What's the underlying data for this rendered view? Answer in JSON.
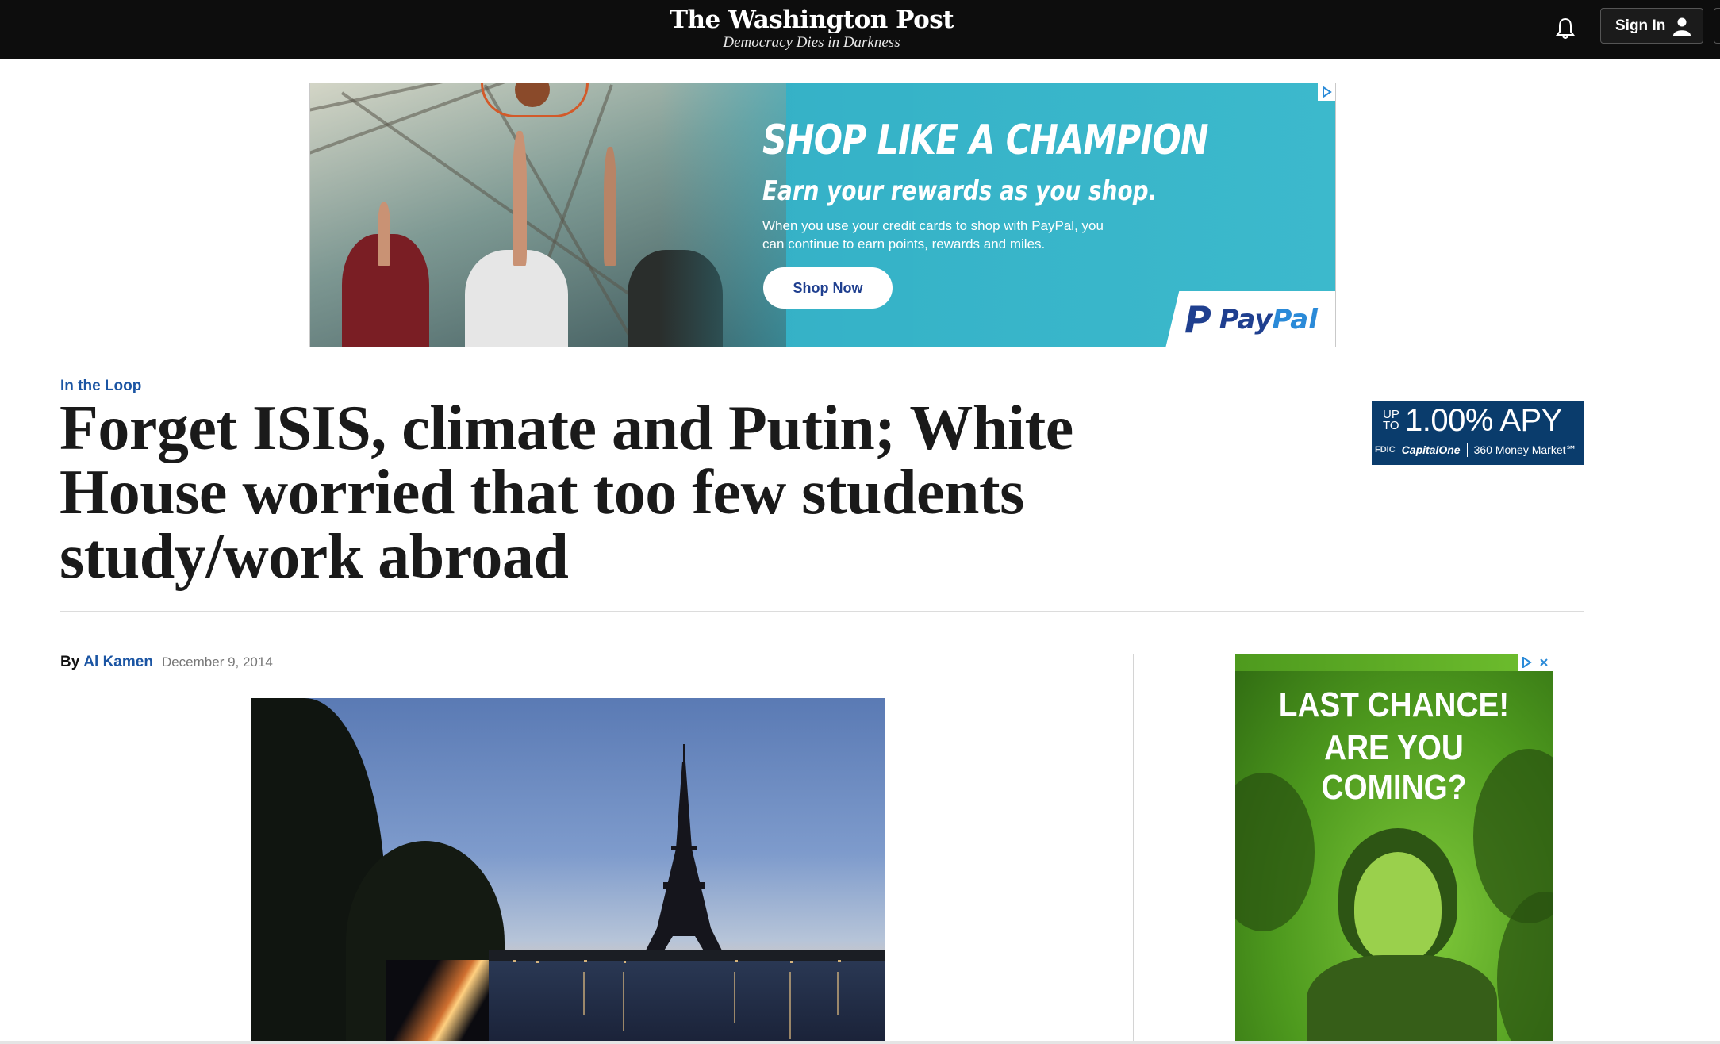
{
  "masthead": {
    "logo": "The Washington Post",
    "tagline": "Democracy Dies in Darkness"
  },
  "header": {
    "signin_label": "Sign In",
    "notification_icon": "bell-icon",
    "user_icon": "user-icon"
  },
  "ad_top": {
    "headline": "SHOP LIKE A CHAMPION",
    "subhead": "Earn your rewards as you shop.",
    "body": "When you use your credit cards to shop with PayPal, you can continue to earn points, rewards and miles.",
    "cta": "Shop Now",
    "brand_pay": "Pay",
    "brand_pal": "Pal",
    "brand_mark": "P",
    "adchoices_icon": "adchoices-icon"
  },
  "article": {
    "kicker": "In the Loop",
    "headline": "Forget ISIS, climate and Putin; White House worried that too few students study/work abroad",
    "by": "By",
    "author": "Al Kamen",
    "date": "December 9, 2014"
  },
  "ad_small": {
    "up_to": "UP TO",
    "rate": "1.00% APY",
    "fdic": "FDIC",
    "brand": "CapitalOne",
    "product": "360 Money Market℠",
    "color": "#0a3c6c"
  },
  "ad_side": {
    "line1": "LAST CHANCE!",
    "line2": "ARE YOU COMING?",
    "accent": "#6fbf2e"
  },
  "colors": {
    "topbar": "#0d0d0d",
    "link": "#1b55a3",
    "paypal_blue": "#1f3f8f"
  }
}
